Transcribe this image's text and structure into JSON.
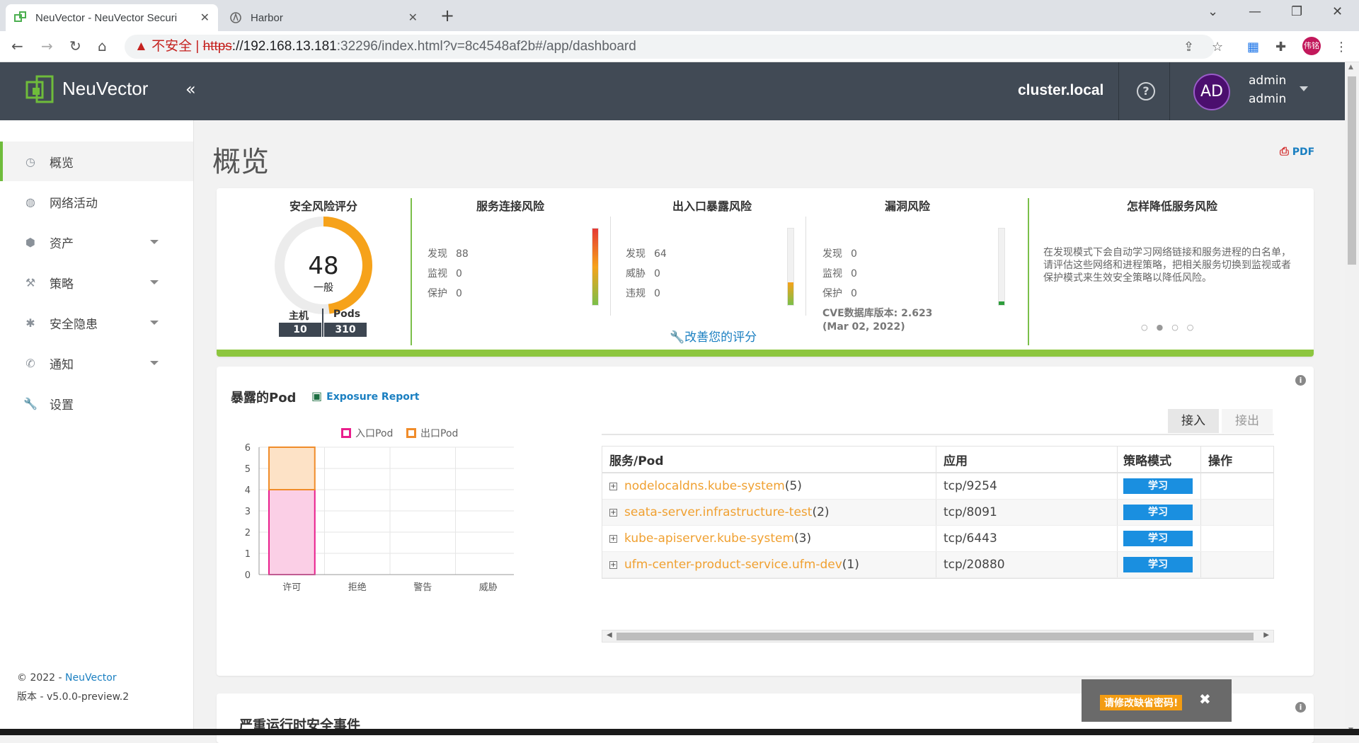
{
  "browser": {
    "tabs": [
      {
        "title": "NeuVector - NeuVector Securi",
        "active": true
      },
      {
        "title": "Harbor",
        "active": false
      }
    ],
    "new_tab": "+",
    "window": {
      "minimize": "—",
      "restore": "❐",
      "close": "✕",
      "tab_list": "⌄"
    },
    "address": {
      "warning": "▲ 不安全 |",
      "scheme": "https",
      "host": "://192.168.13.181",
      "rest": ":32296/index.html?v=8c4548af2b#/app/dashboard"
    },
    "profile": "伟铭"
  },
  "header": {
    "brand": "NeuVector",
    "collapse": "«",
    "cluster": "cluster.local",
    "help": "?",
    "avatar": "AD",
    "user_line1": "admin",
    "user_line2": "admin"
  },
  "sidebar": {
    "items": [
      {
        "label": "概览",
        "icon": "dashboard-icon",
        "glyph": "◷"
      },
      {
        "label": "网络活动",
        "icon": "globe-icon",
        "glyph": "◍"
      },
      {
        "label": "资产",
        "icon": "assets-icon",
        "glyph": "⬢"
      },
      {
        "label": "策略",
        "icon": "hammer-icon",
        "glyph": "⚒"
      },
      {
        "label": "安全隐患",
        "icon": "bug-icon",
        "glyph": "✱"
      },
      {
        "label": "通知",
        "icon": "phone-icon",
        "glyph": "✆"
      },
      {
        "label": "设置",
        "icon": "wrench-icon",
        "glyph": "🔧"
      }
    ],
    "copyright_prefix": "© 2022 - ",
    "copyright_link": "NeuVector",
    "version": "版本 - v5.0.0-preview.2"
  },
  "page": {
    "title": "概览",
    "pdf": "PDF"
  },
  "risk": {
    "score_title": "安全风险评分",
    "score": "48",
    "score_fraction": 0.48,
    "score_label": "一般",
    "hosts_label": "主机",
    "hosts": "10",
    "pods_label": "Pods",
    "pods": "310",
    "service": {
      "title": "服务连接风险",
      "rows": [
        {
          "label": "发现",
          "value": "88"
        },
        {
          "label": "监视",
          "value": "0"
        },
        {
          "label": "保护",
          "value": "0"
        }
      ]
    },
    "ingress": {
      "title": "出入口暴露风险",
      "rows": [
        {
          "label": "发现",
          "value": "64"
        },
        {
          "label": "威胁",
          "value": "0"
        },
        {
          "label": "违规",
          "value": "0"
        }
      ]
    },
    "vuln": {
      "title": "漏洞风险",
      "rows": [
        {
          "label": "发现",
          "value": "0"
        },
        {
          "label": "监视",
          "value": "0"
        },
        {
          "label": "保护",
          "value": "0"
        }
      ],
      "cve_line1": "CVE数据库版本: 2.623",
      "cve_line2": "(Mar 02, 2022)"
    },
    "improve": "改善您的评分",
    "howto_title": "怎样降低服务风险",
    "howto_text": "在发现模式下会自动学习网络链接和服务进程的白名单，请评估这些网络和进程策略，把相关服务切换到监视或者保护模式来生效安全策略以降低风险。",
    "dots": "○●○○"
  },
  "exposure": {
    "title": "暴露的Pod",
    "report": "Exposure Report",
    "tab_in": "接入",
    "tab_out": "接出",
    "columns": [
      "服务/Pod",
      "应用",
      "策略模式",
      "操作"
    ],
    "rows": [
      {
        "name": "nodelocaldns.kube-system",
        "count": "(5)",
        "app": "tcp/9254",
        "mode": "学习"
      },
      {
        "name": "seata-server.infrastructure-test",
        "count": "(2)",
        "app": "tcp/8091",
        "mode": "学习"
      },
      {
        "name": "kube-apiserver.kube-system",
        "count": "(3)",
        "app": "tcp/6443",
        "mode": "学习"
      },
      {
        "name": "ufm-center-product-service.ufm-dev",
        "count": "(1)",
        "app": "tcp/20880",
        "mode": "学习"
      }
    ]
  },
  "chart_data": {
    "type": "bar",
    "stacked": true,
    "categories": [
      "许可",
      "拒绝",
      "警告",
      "威胁"
    ],
    "series": [
      {
        "name": "入口Pod",
        "values": [
          4,
          0,
          0,
          0
        ],
        "color": "#e91e8c",
        "fill": "#fbcfe6"
      },
      {
        "name": "出口Pod",
        "values": [
          2,
          0,
          0,
          0
        ],
        "color": "#f08c2a",
        "fill": "#fde2c6"
      }
    ],
    "ylim": [
      0,
      6
    ],
    "yticks": [
      "0",
      "1",
      "2",
      "3",
      "4",
      "5",
      "6"
    ],
    "grid": true,
    "legend": "top"
  },
  "runtime": {
    "title": "严重运行时安全事件"
  },
  "toast": {
    "message": "请修改缺省密码!",
    "close": "✖"
  },
  "colors": {
    "accent": "#8dc63f",
    "header": "#414a55",
    "link": "#1a7fc1",
    "pod_link": "#f0a030",
    "learn": "#1a8fe0"
  }
}
